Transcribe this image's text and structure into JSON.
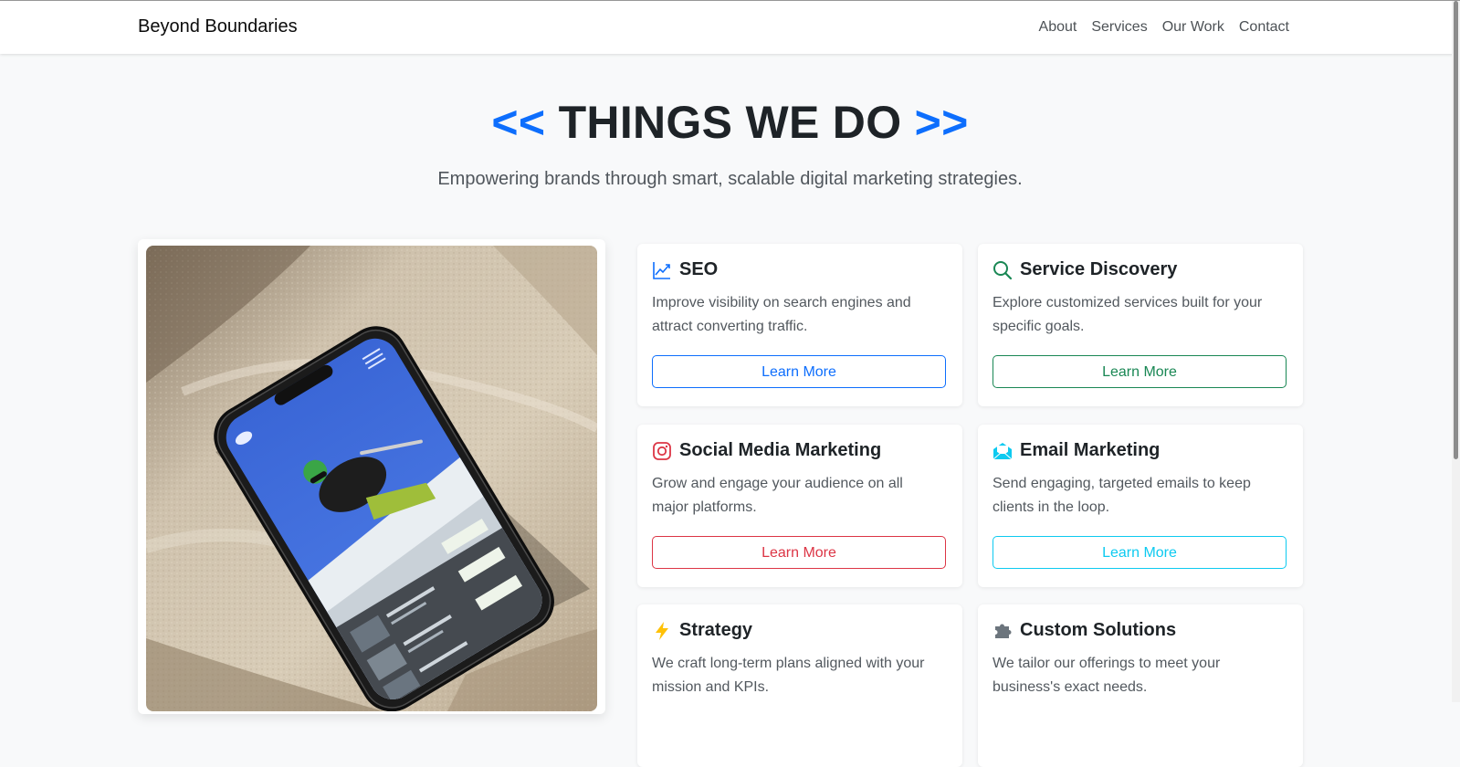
{
  "nav": {
    "brand": "Beyond Boundaries",
    "links": [
      "About",
      "Services",
      "Our Work",
      "Contact"
    ]
  },
  "hero": {
    "bracket_left": "<<",
    "title": "THINGS WE DO",
    "bracket_right": ">>",
    "subtitle": "Empowering brands through smart, scalable digital marketing strategies."
  },
  "image": {
    "description_icon": "phone-on-rock-image",
    "screen_labels": [
      "BOOK NOW",
      "BOOK NOW",
      "BOOK NOW"
    ]
  },
  "services": [
    {
      "title": "SEO",
      "icon": "chart-line-icon",
      "description": "Improve visibility on search engines and attract converting traffic.",
      "button": "Learn More",
      "color": "#0d6efd"
    },
    {
      "title": "Service Discovery",
      "icon": "search-icon",
      "description": "Explore customized services built for your specific goals.",
      "button": "Learn More",
      "color": "#198754"
    },
    {
      "title": "Social Media Marketing",
      "icon": "instagram-icon",
      "description": "Grow and engage your audience on all major platforms.",
      "button": "Learn More",
      "color": "#dc3545"
    },
    {
      "title": "Email Marketing",
      "icon": "envelope-open-icon",
      "description": "Send engaging, targeted emails to keep clients in the loop.",
      "button": "Learn More",
      "color": "#0dcaf0"
    },
    {
      "title": "Strategy",
      "icon": "lightning-icon",
      "description": "We craft long-term plans aligned with your mission and KPIs."
    },
    {
      "title": "Custom Solutions",
      "icon": "puzzle-icon",
      "description": "We tailor our offerings to meet your business's exact needs."
    }
  ]
}
